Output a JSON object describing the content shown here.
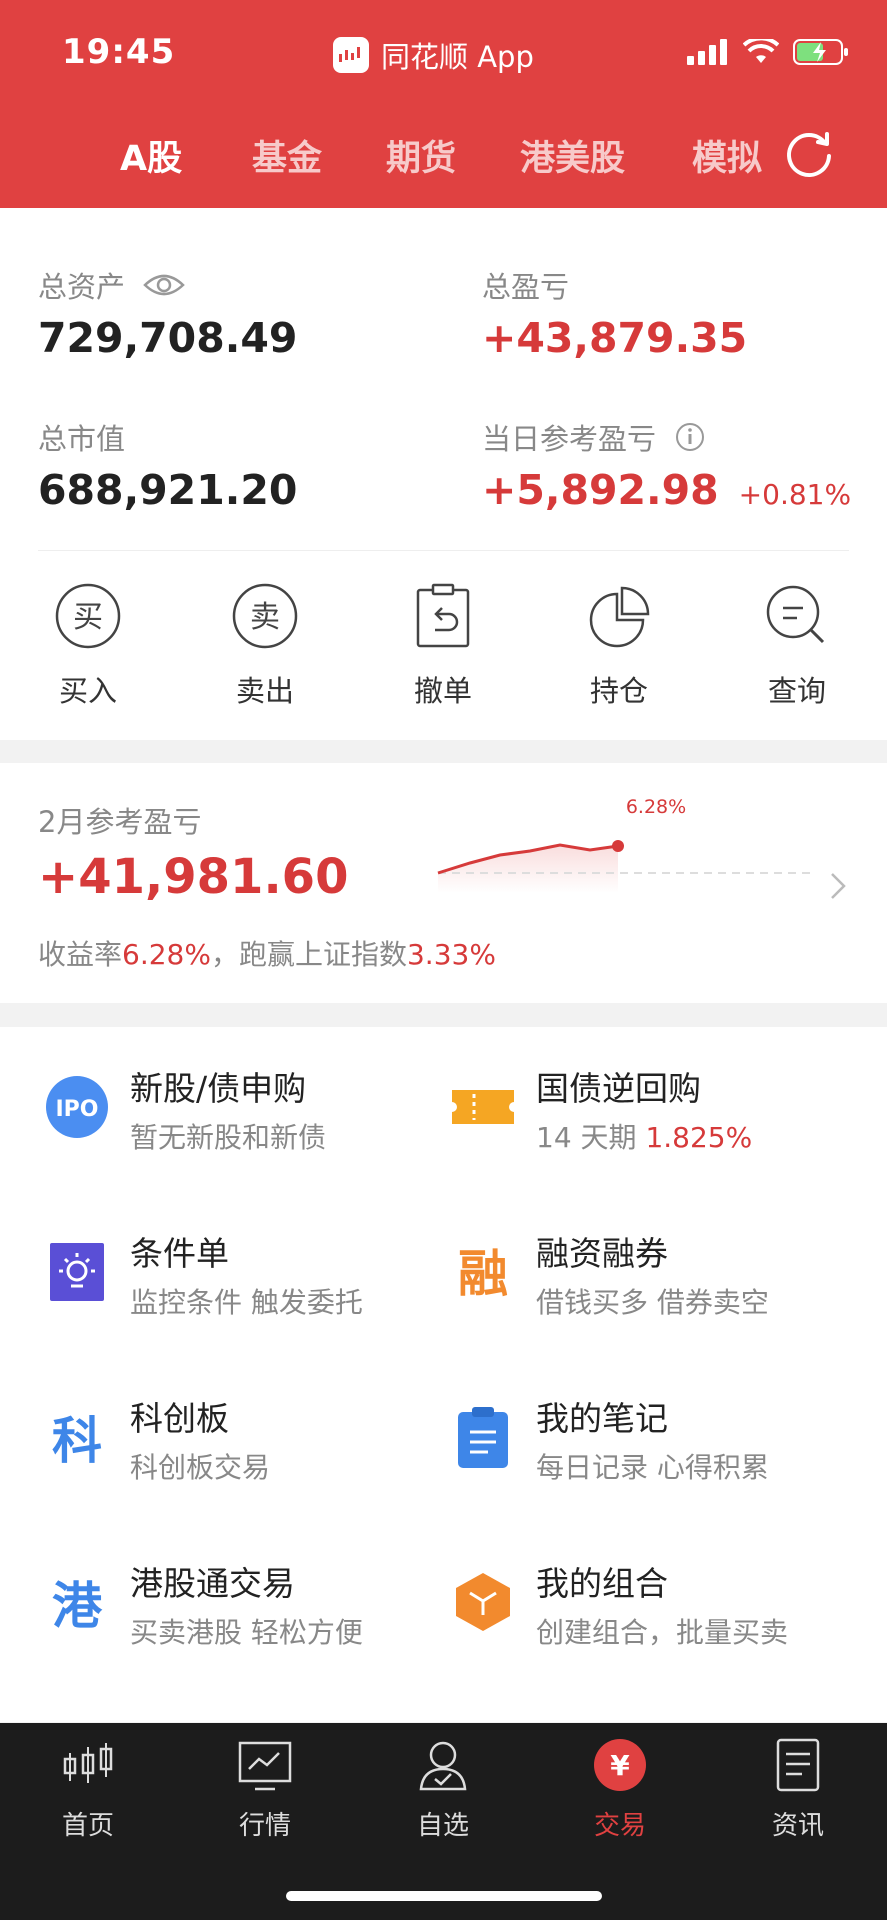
{
  "status": {
    "time": "19:45",
    "app": "同花顺 App"
  },
  "tabs": [
    "A股",
    "基金",
    "期货",
    "港美股",
    "模拟"
  ],
  "assets": {
    "total_assets_label": "总资产",
    "total_assets": "729,708.49",
    "total_pnl_label": "总盈亏",
    "total_pnl": "+43,879.35",
    "market_value_label": "总市值",
    "market_value": "688,921.20",
    "daily_pnl_label": "当日参考盈亏",
    "daily_pnl": "+5,892.98",
    "daily_pnl_pct": "+0.81%"
  },
  "actions": [
    "买入",
    "卖出",
    "撤单",
    "持仓",
    "查询"
  ],
  "monthly": {
    "label": "2月参考盈亏",
    "value": "+41,981.60",
    "rate_label": "收益率",
    "rate": "6.28%",
    "beat_label": "，跑赢上证指数",
    "beat": "3.33%",
    "spark_label": "6.28%"
  },
  "features": [
    {
      "title": "新股/债申购",
      "sub": "暂无新股和新债"
    },
    {
      "title": "国债逆回购",
      "sub_prefix": "14 天期",
      "sub_value": "1.825%"
    },
    {
      "title": "条件单",
      "sub": "监控条件 触发委托"
    },
    {
      "title": "融资融券",
      "sub": "借钱买多 借券卖空"
    },
    {
      "title": "科创板",
      "sub": "科创板交易"
    },
    {
      "title": "我的笔记",
      "sub": "每日记录 心得积累"
    },
    {
      "title": "港股通交易",
      "sub": "买卖港股 轻松方便"
    },
    {
      "title": "我的组合",
      "sub": "创建组合，批量买卖"
    }
  ],
  "icon_text": {
    "ipo": "IPO",
    "buy": "买",
    "sell": "卖",
    "rong": "融",
    "ke": "科",
    "gang": "港",
    "yen": "¥"
  },
  "nav": [
    "首页",
    "行情",
    "自选",
    "交易",
    "资讯"
  ],
  "colors": {
    "brand_red": "#e04141",
    "profit_red": "#d63a3a",
    "dark_nav": "#1c1c1c"
  }
}
